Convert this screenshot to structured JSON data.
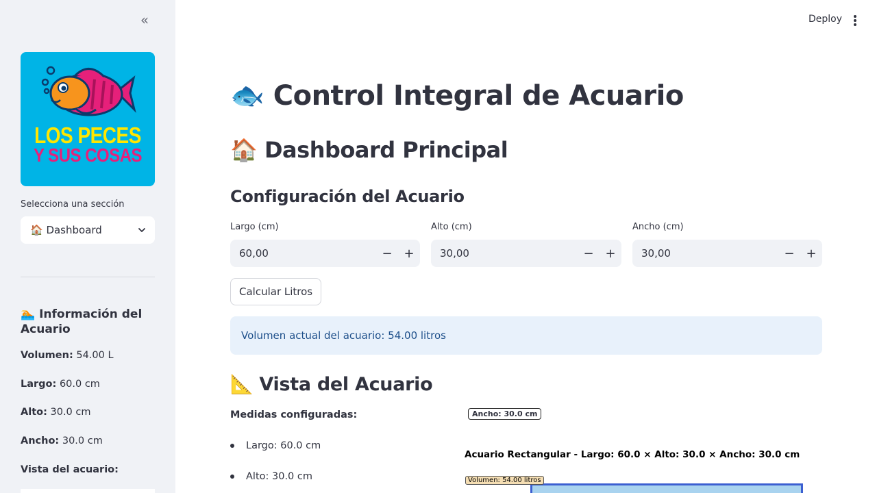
{
  "sidebar": {
    "collapse_icon": "double-chevron-left-icon",
    "logo": {
      "line1": "LOS PECES",
      "line2": "Y SUS COSAS",
      "bg": "#00b4e6"
    },
    "select_label": "Selecciona una sección",
    "select_value": "🏠 Dashboard",
    "info_title": "🏊 Información del Acuario",
    "info": [
      {
        "key": "Volumen:",
        "value": "54.00 L"
      },
      {
        "key": "Largo:",
        "value": "60.0 cm"
      },
      {
        "key": "Alto:",
        "value": "30.0 cm"
      },
      {
        "key": "Ancho:",
        "value": "30.0 cm"
      }
    ],
    "vista_label": "Vista del acuario:"
  },
  "header": {
    "deploy_label": "Deploy",
    "menu_icon": "kebab-menu-icon"
  },
  "main": {
    "title": "🐟 Control Integral de Acuario",
    "subtitle": "🏠 Dashboard Principal",
    "config_title": "Configuración del Acuario",
    "inputs": [
      {
        "label": "Largo (cm)",
        "value": "60,00"
      },
      {
        "label": "Alto (cm)",
        "value": "30,00"
      },
      {
        "label": "Ancho (cm)",
        "value": "30,00"
      }
    ],
    "stepper_minus": "−",
    "stepper_plus": "+",
    "calc_button": "Calcular Litros",
    "alert_text": "Volumen actual del acuario: 54.00 litros",
    "vista_title": "📐 Vista del Acuario",
    "medidas_title": "Medidas configuradas:",
    "medidas": [
      "Largo: 60.0 cm",
      "Alto: 30.0 cm"
    ],
    "plot": {
      "ancho_tag": "Ancho: 30.0 cm",
      "title": "Acuario Rectangular - Largo: 60.0 × Alto: 30.0 × Ancho: 30.0 cm",
      "volume_tag": "Volumen: 54.00 litros"
    }
  },
  "colors": {
    "sidebar_bg": "#f0f2f6",
    "alert_bg": "#e8f1fb",
    "alert_text": "#1d4f8a",
    "tank_fill": "#a9d3ef",
    "tank_border": "#3c5fd1"
  }
}
